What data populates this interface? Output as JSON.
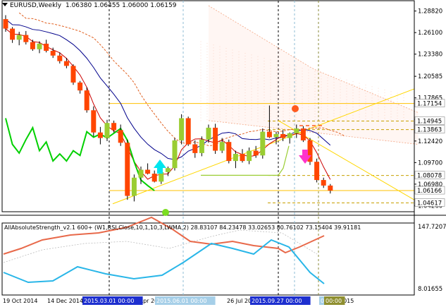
{
  "window": {
    "symbol_title": "EURUSD,Weekly",
    "ohlc": "1.06380 1.06455 1.06000 1.06159",
    "indicator_line": "AllAbsoluteStrength_v2.1 600+ (W1,RSI,Close,10,1,10,3,LWMA,2) 28.83107 84.23478 33.02653 80.76102 73.15404 39.91181"
  },
  "colors": {
    "bull": "#9acd32",
    "bear": "#ff4500",
    "kijun": "#cc0000",
    "tenkan": "#00008b",
    "chikou": "#00d000",
    "level": "#ffc000",
    "trend": "#ffd700",
    "ind_red": "#e8694a",
    "ind_blue": "#29b6e8",
    "price_tag": "#ffffff",
    "price_tag_active": "#ffd700"
  },
  "icons": {
    "up_arrow": "up-arrow-signal-icon",
    "down_arrow": "down-arrow-signal-icon",
    "dot_lime": "lime-dot-marker-icon",
    "dot_orange": "orange-dot-marker-icon"
  },
  "price_axis": {
    "ticks": [
      "1.28820",
      "1.26100",
      "1.23380",
      "1.20585",
      "1.17865",
      "1.15145",
      "1.12420",
      "1.09700",
      "1.06980",
      "1.04260"
    ],
    "tags": [
      {
        "text": "1.17154",
        "style": "plain"
      },
      {
        "text": "1.14945",
        "style": "plain"
      },
      {
        "text": "1.13863",
        "style": "plain"
      },
      {
        "text": "1.08078",
        "style": "plain"
      },
      {
        "text": "1.06166",
        "style": "plain"
      },
      {
        "text": "1.04617",
        "style": "plain"
      }
    ]
  },
  "indicator_axis": {
    "ticks": [
      "147.7207",
      "8.01655"
    ]
  },
  "time_axis": {
    "labels": [
      "19 Oct 2014",
      "14 Dec 2014",
      "5 Apr 2015",
      "26 Jul 2015",
      "2015"
    ],
    "highlighted": [
      {
        "text": "2015.03.01 00:00",
        "style": "blue"
      },
      {
        "text": "2015.06.01 00:00",
        "style": "light"
      },
      {
        "text": "2015.09.27 00:00",
        "style": "blue"
      },
      {
        "text": "00:00",
        "style": "light"
      },
      {
        "text": "00:00",
        "style": "olive"
      }
    ]
  },
  "chart_data": {
    "type": "candlestick",
    "symbol": "EURUSD",
    "timeframe": "Weekly",
    "ylim": [
      1.035,
      1.295
    ],
    "levels": [
      1.17154,
      1.14945,
      1.13863,
      1.08078,
      1.06166,
      1.04617
    ],
    "candles": [
      [
        1.278,
        1.283,
        1.262,
        1.266
      ],
      [
        1.266,
        1.268,
        1.248,
        1.252
      ],
      [
        1.252,
        1.262,
        1.245,
        1.258
      ],
      [
        1.258,
        1.263,
        1.246,
        1.249
      ],
      [
        1.249,
        1.252,
        1.238,
        1.24
      ],
      [
        1.24,
        1.25,
        1.235,
        1.247
      ],
      [
        1.247,
        1.252,
        1.236,
        1.238
      ],
      [
        1.238,
        1.242,
        1.229,
        1.232
      ],
      [
        1.232,
        1.236,
        1.222,
        1.225
      ],
      [
        1.225,
        1.229,
        1.216,
        1.219
      ],
      [
        1.219,
        1.221,
        1.195,
        1.198
      ],
      [
        1.198,
        1.2,
        1.184,
        1.188
      ],
      [
        1.188,
        1.192,
        1.16,
        1.163
      ],
      [
        1.163,
        1.168,
        1.13,
        1.135
      ],
      [
        1.135,
        1.142,
        1.12,
        1.128
      ],
      [
        1.128,
        1.151,
        1.124,
        1.147
      ],
      [
        1.147,
        1.15,
        1.135,
        1.138
      ],
      [
        1.138,
        1.145,
        1.118,
        1.122
      ],
      [
        1.122,
        1.126,
        1.05,
        1.055
      ],
      [
        1.055,
        1.082,
        1.048,
        1.078
      ],
      [
        1.078,
        1.092,
        1.07,
        1.088
      ],
      [
        1.088,
        1.096,
        1.082,
        1.083
      ],
      [
        1.083,
        1.087,
        1.072,
        1.073
      ],
      [
        1.073,
        1.087,
        1.07,
        1.085
      ],
      [
        1.085,
        1.092,
        1.08,
        1.09
      ],
      [
        1.09,
        1.128,
        1.087,
        1.125
      ],
      [
        1.125,
        1.158,
        1.12,
        1.153
      ],
      [
        1.153,
        1.155,
        1.118,
        1.12
      ],
      [
        1.12,
        1.125,
        1.103,
        1.109
      ],
      [
        1.109,
        1.13,
        1.105,
        1.126
      ],
      [
        1.126,
        1.145,
        1.122,
        1.141
      ],
      [
        1.141,
        1.146,
        1.108,
        1.112
      ],
      [
        1.112,
        1.128,
        1.109,
        1.123
      ],
      [
        1.123,
        1.126,
        1.096,
        1.099
      ],
      [
        1.099,
        1.112,
        1.09,
        1.108
      ],
      [
        1.108,
        1.114,
        1.097,
        1.099
      ],
      [
        1.099,
        1.116,
        1.095,
        1.112
      ],
      [
        1.112,
        1.118,
        1.103,
        1.106
      ],
      [
        1.106,
        1.14,
        1.102,
        1.136
      ],
      [
        1.136,
        1.169,
        1.128,
        1.129
      ],
      [
        1.129,
        1.136,
        1.12,
        1.133
      ],
      [
        1.133,
        1.138,
        1.124,
        1.128
      ],
      [
        1.128,
        1.135,
        1.121,
        1.134
      ],
      [
        1.134,
        1.145,
        1.128,
        1.14
      ],
      [
        1.14,
        1.143,
        1.123,
        1.125
      ],
      [
        1.125,
        1.128,
        1.094,
        1.098
      ],
      [
        1.098,
        1.102,
        1.072,
        1.075
      ],
      [
        1.075,
        1.078,
        1.065,
        1.068
      ],
      [
        1.068,
        1.07,
        1.058,
        1.0616
      ]
    ]
  }
}
